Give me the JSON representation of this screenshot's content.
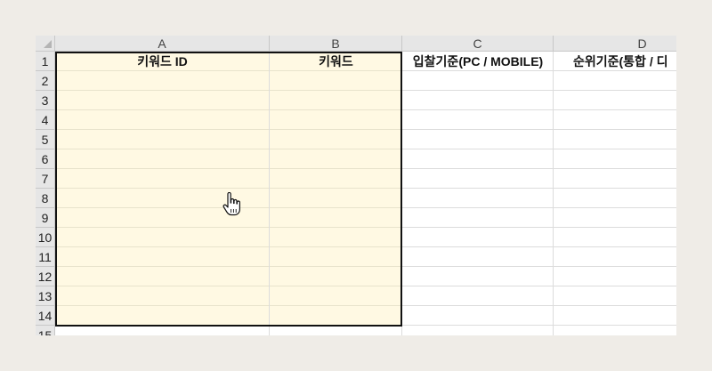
{
  "columns": [
    "A",
    "B",
    "C",
    "D"
  ],
  "rows": [
    "1",
    "2",
    "3",
    "4",
    "5",
    "6",
    "7",
    "8",
    "9",
    "10",
    "11",
    "12",
    "13",
    "14",
    "15"
  ],
  "header_row": {
    "a1": "키워드 ID",
    "b1": "키워드",
    "c1": "입찰기준(PC / MOBILE)",
    "d1": "순위기준(통합 / 디"
  },
  "colors": {
    "selection_fill": "#fff9e3",
    "selection_border": "#111111",
    "header_bg": "#e6e6e6"
  },
  "icons": {
    "cursor": "hand-pointer-icon"
  }
}
